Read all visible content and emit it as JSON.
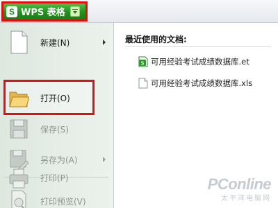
{
  "app": {
    "logo_letter": "S",
    "title": "WPS 表格",
    "brand_color": "#23901e"
  },
  "menu": {
    "items": [
      {
        "label": "新建(N)",
        "icon": "new-document-icon",
        "enabled": true,
        "submenu": true
      },
      {
        "label": "打开(O)",
        "icon": "open-folder-icon",
        "enabled": true,
        "submenu": false
      },
      {
        "label": "保存(S)",
        "icon": "save-disk-icon",
        "enabled": false,
        "submenu": false
      },
      {
        "label": "另存为(A)",
        "icon": "save-as-icon",
        "enabled": false,
        "submenu": true
      },
      {
        "label": "打印(P)",
        "icon": "printer-icon",
        "enabled": false,
        "submenu": false
      },
      {
        "label": "打印预览(V)",
        "icon": "print-preview-icon",
        "enabled": false,
        "submenu": false
      }
    ]
  },
  "recent": {
    "heading": "最近使用的文档:",
    "documents": [
      {
        "name": "可用经验考试成绩数据库.et",
        "icon": "et-spreadsheet-icon"
      },
      {
        "name": "可用经验考试成绩数据库.xls",
        "icon": "xls-file-icon"
      }
    ]
  },
  "watermark": {
    "brand": "PConline",
    "sub": "太平洋电脑网"
  },
  "annotation_color": "#e01010"
}
